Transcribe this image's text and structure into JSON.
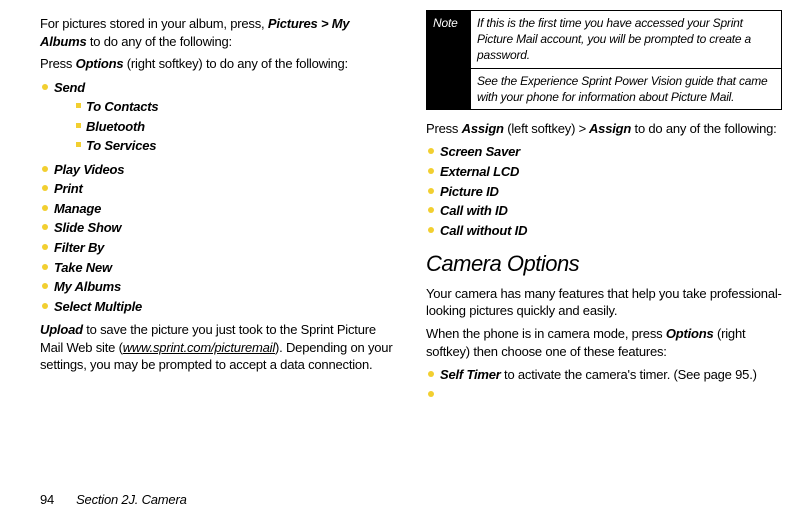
{
  "left": {
    "intro1_a": "For pictures stored in your album, press, ",
    "intro1_b": "Pictures > My Albums",
    "intro1_c": " to do any of the following:",
    "intro2_a": "Press ",
    "intro2_b": "Options",
    "intro2_c": " (right softkey) to do any of the following:",
    "send": "Send",
    "send_sub": [
      "To Contacts",
      "Bluetooth",
      "To Services"
    ],
    "items": [
      "Play Videos",
      "Print",
      "Manage",
      "Slide Show",
      "Filter By",
      "Take New",
      "My Albums",
      "Select Multiple"
    ],
    "upload_a": "Upload",
    "upload_b": " to save the picture you just took to the Sprint Picture Mail Web site (",
    "upload_link": "www.sprint.com/picturemail",
    "upload_c": "). Depending on your settings, you may be prompted to accept a data connection."
  },
  "right": {
    "note_label": "Note",
    "note1": "If this is the first time you have accessed your Sprint Picture Mail account, you will be prompted to create a password.",
    "note2": "See the Experience Sprint Power Vision guide that came with your phone for information about Picture Mail.",
    "assign_a": "Press ",
    "assign_b": "Assign",
    "assign_c": " (left softkey) ",
    "assign_gt": ">",
    "assign_d": " Assign",
    "assign_e": " to do any of the following:",
    "assign_items": [
      "Screen Saver",
      "External LCD",
      "Picture ID",
      "Call with ID",
      "Call without ID"
    ],
    "cam_heading": "Camera Options",
    "cam_p1": "Your camera has many features that help you take professional-looking pictures quickly and easily.",
    "cam_p2_a": "When the phone is in camera mode, press ",
    "cam_p2_b": "Options",
    "cam_p2_c": " (right softkey) then choose one of these features:",
    "self_a": "Self Timer",
    "self_b": " to activate the camera's timer. (See page 95.)"
  },
  "footer": {
    "page": "94",
    "section": "Section 2J. Camera"
  }
}
